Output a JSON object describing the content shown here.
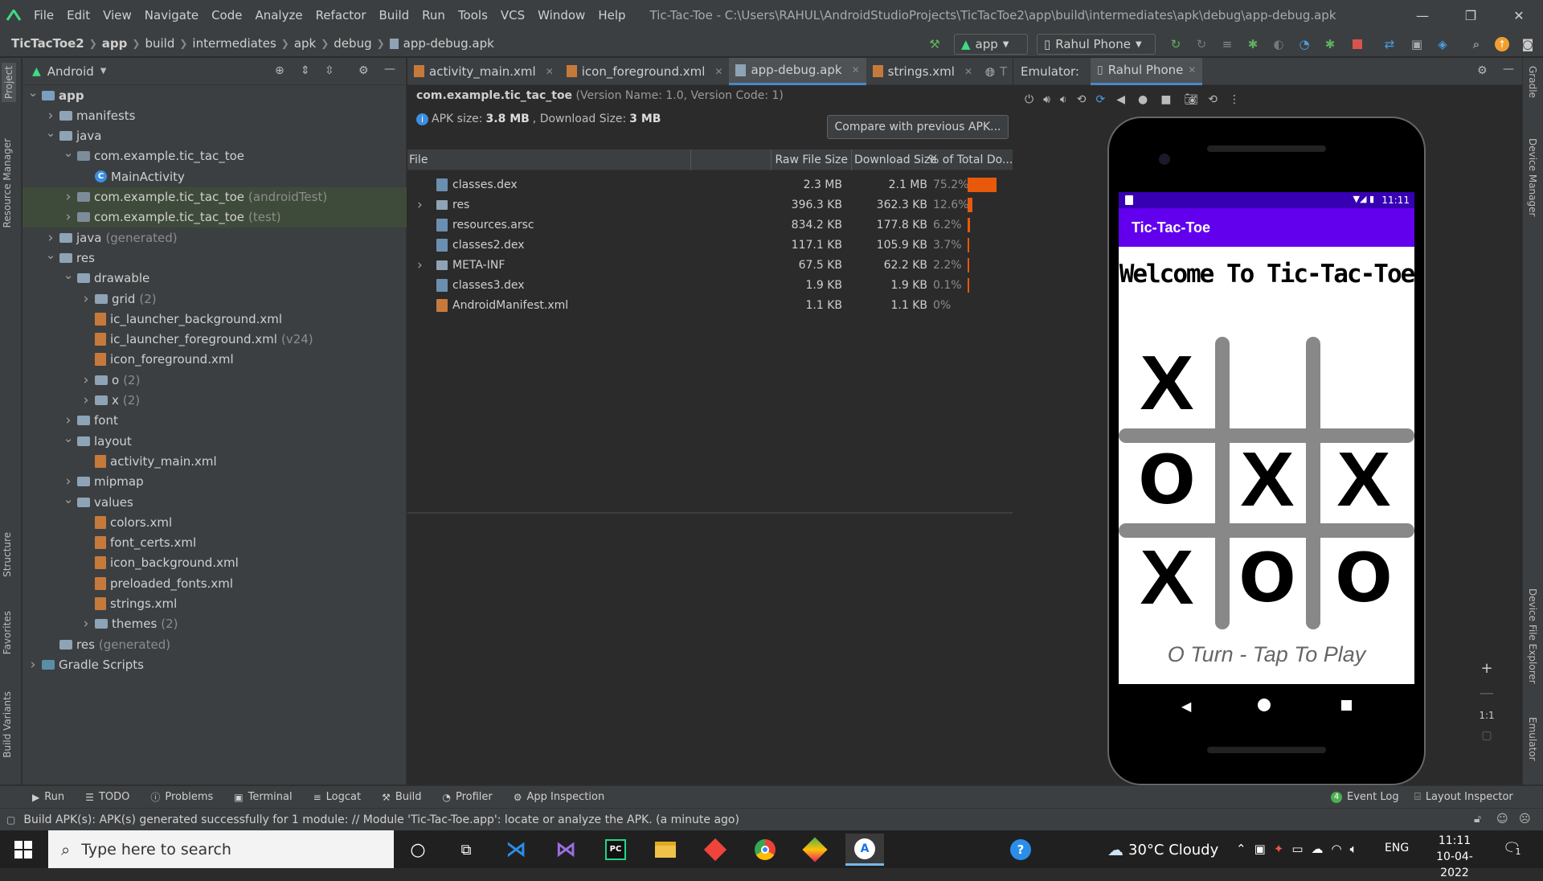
{
  "titlebar": {
    "menus": [
      "File",
      "Edit",
      "View",
      "Navigate",
      "Code",
      "Analyze",
      "Refactor",
      "Build",
      "Run",
      "Tools",
      "VCS",
      "Window",
      "Help"
    ],
    "window_title": "Tic-Tac-Toe - C:\\Users\\RAHUL\\AndroidStudioProjects\\TicTacToe2\\app\\build\\intermediates\\apk\\debug\\app-debug.apk"
  },
  "navbar": {
    "breadcrumbs": [
      "TicTacToe2",
      "app",
      "build",
      "intermediates",
      "apk",
      "debug",
      "app-debug.apk"
    ],
    "run_config": "app",
    "device": "Rahul Phone"
  },
  "left_strip": {
    "tabs": [
      "Project",
      "Resource Manager",
      "Structure",
      "Favorites",
      "Build Variants"
    ]
  },
  "right_strip": {
    "tabs": [
      "Gradle",
      "Device Manager",
      "Device File Explorer",
      "Emulator"
    ]
  },
  "project": {
    "view": "Android",
    "tree": [
      {
        "label": "app",
        "suffix": "",
        "type": "module",
        "indent": 0,
        "arrow": "down"
      },
      {
        "label": "manifests",
        "suffix": "",
        "type": "folder",
        "indent": 1,
        "arrow": "right"
      },
      {
        "label": "java",
        "suffix": "",
        "type": "folder",
        "indent": 1,
        "arrow": "down"
      },
      {
        "label": "com.example.tic_tac_toe",
        "suffix": "",
        "type": "package",
        "indent": 2,
        "arrow": "down"
      },
      {
        "label": "MainActivity",
        "suffix": "",
        "type": "class",
        "indent": 3,
        "arrow": ""
      },
      {
        "label": "com.example.tic_tac_toe",
        "suffix": "(androidTest)",
        "type": "package",
        "indent": 2,
        "arrow": "right",
        "selected": true
      },
      {
        "label": "com.example.tic_tac_toe",
        "suffix": "(test)",
        "type": "package",
        "indent": 2,
        "arrow": "right",
        "selected": true
      },
      {
        "label": "java",
        "suffix": "(generated)",
        "type": "folder",
        "indent": 1,
        "arrow": "right"
      },
      {
        "label": "res",
        "suffix": "",
        "type": "folder",
        "indent": 1,
        "arrow": "down"
      },
      {
        "label": "drawable",
        "suffix": "",
        "type": "folder",
        "indent": 2,
        "arrow": "down"
      },
      {
        "label": "grid",
        "suffix": "(2)",
        "type": "folder",
        "indent": 3,
        "arrow": "right"
      },
      {
        "label": "ic_launcher_background.xml",
        "suffix": "",
        "type": "xml",
        "indent": 3,
        "arrow": ""
      },
      {
        "label": "ic_launcher_foreground.xml",
        "suffix": "(v24)",
        "type": "xml",
        "indent": 3,
        "arrow": ""
      },
      {
        "label": "icon_foreground.xml",
        "suffix": "",
        "type": "xml",
        "indent": 3,
        "arrow": ""
      },
      {
        "label": "o",
        "suffix": "(2)",
        "type": "folder",
        "indent": 3,
        "arrow": "right"
      },
      {
        "label": "x",
        "suffix": "(2)",
        "type": "folder",
        "indent": 3,
        "arrow": "right"
      },
      {
        "label": "font",
        "suffix": "",
        "type": "folder",
        "indent": 2,
        "arrow": "right"
      },
      {
        "label": "layout",
        "suffix": "",
        "type": "folder",
        "indent": 2,
        "arrow": "down"
      },
      {
        "label": "activity_main.xml",
        "suffix": "",
        "type": "xml",
        "indent": 3,
        "arrow": ""
      },
      {
        "label": "mipmap",
        "suffix": "",
        "type": "folder",
        "indent": 2,
        "arrow": "right"
      },
      {
        "label": "values",
        "suffix": "",
        "type": "folder",
        "indent": 2,
        "arrow": "down"
      },
      {
        "label": "colors.xml",
        "suffix": "",
        "type": "xml",
        "indent": 3,
        "arrow": ""
      },
      {
        "label": "font_certs.xml",
        "suffix": "",
        "type": "xml",
        "indent": 3,
        "arrow": ""
      },
      {
        "label": "icon_background.xml",
        "suffix": "",
        "type": "xml",
        "indent": 3,
        "arrow": ""
      },
      {
        "label": "preloaded_fonts.xml",
        "suffix": "",
        "type": "xml",
        "indent": 3,
        "arrow": ""
      },
      {
        "label": "strings.xml",
        "suffix": "",
        "type": "xml",
        "indent": 3,
        "arrow": ""
      },
      {
        "label": "themes",
        "suffix": "(2)",
        "type": "folder",
        "indent": 3,
        "arrow": "right"
      },
      {
        "label": "res",
        "suffix": "(generated)",
        "type": "folder",
        "indent": 1,
        "arrow": ""
      },
      {
        "label": "Gradle Scripts",
        "suffix": "",
        "type": "gradle",
        "indent": 0,
        "arrow": "right"
      }
    ]
  },
  "editor_tabs": [
    {
      "label": "activity_main.xml",
      "active": false
    },
    {
      "label": "icon_foreground.xml",
      "active": false
    },
    {
      "label": "app-debug.apk",
      "active": true
    },
    {
      "label": "strings.xml",
      "active": false
    },
    {
      "label": "T",
      "active": false
    }
  ],
  "apk": {
    "package": "com.example.tic_tac_toe",
    "version_info": "(Version Name: 1.0, Version Code: 1)",
    "size_label": "APK size:",
    "size_value": "3.8 MB",
    "download_label": ", Download Size:",
    "download_value": "3 MB",
    "compare_button": "Compare with previous APK...",
    "columns": [
      "File",
      "Raw File Size",
      "Download Size",
      "% of Total Do..."
    ],
    "rows": [
      {
        "name": "classes.dex",
        "raw": "2.3 MB",
        "dl": "2.1 MB",
        "pct": "75.2%",
        "fraction": 0.752,
        "expandable": false
      },
      {
        "name": "res",
        "raw": "396.3 KB",
        "dl": "362.3 KB",
        "pct": "12.6%",
        "fraction": 0.126,
        "expandable": true
      },
      {
        "name": "resources.arsc",
        "raw": "834.2 KB",
        "dl": "177.8 KB",
        "pct": "6.2%",
        "fraction": 0.062,
        "expandable": false
      },
      {
        "name": "classes2.dex",
        "raw": "117.1 KB",
        "dl": "105.9 KB",
        "pct": "3.7%",
        "fraction": 0.037,
        "expandable": false
      },
      {
        "name": "META-INF",
        "raw": "67.5 KB",
        "dl": "62.2 KB",
        "pct": "2.2%",
        "fraction": 0.022,
        "expandable": true
      },
      {
        "name": "classes3.dex",
        "raw": "1.9 KB",
        "dl": "1.9 KB",
        "pct": "0.1%",
        "fraction": 0.001,
        "expandable": false
      },
      {
        "name": "AndroidManifest.xml",
        "raw": "1.1 KB",
        "dl": "1.1 KB",
        "pct": "0%",
        "fraction": 0,
        "expandable": false
      }
    ],
    "bar_color": "#e8590c"
  },
  "emulator": {
    "label": "Emulator:",
    "device_tab": "Rahul Phone",
    "status_time": "11:11",
    "app_bar_title": "Tic-Tac-Toe",
    "app_bar_color": "#6200ee",
    "status_bar_color": "#3700b3",
    "welcome": "Welcome To Tic-Tac-Toe",
    "board": [
      "X",
      "",
      "",
      "O",
      "X",
      "X",
      "X",
      "O",
      "O"
    ],
    "turn_text": "O Turn - Tap To Play",
    "zoom_ratio": "1:1"
  },
  "bottom_tabs": [
    "Run",
    "TODO",
    "Problems",
    "Terminal",
    "Logcat",
    "Build",
    "Profiler",
    "App Inspection"
  ],
  "bottom_right_tabs": {
    "event_log": "Event Log",
    "event_count": "4",
    "layout_inspector": "Layout Inspector"
  },
  "status_message": "Build APK(s): APK(s) generated successfully for 1 module: // Module 'Tic-Tac-Toe.app': locate or analyze the APK. (a minute ago)",
  "taskbar": {
    "search_placeholder": "Type here to search",
    "weather": "30°C  Cloudy",
    "lang": "ENG",
    "time": "11:11",
    "date": "10-04-2022",
    "notifications": "1"
  }
}
